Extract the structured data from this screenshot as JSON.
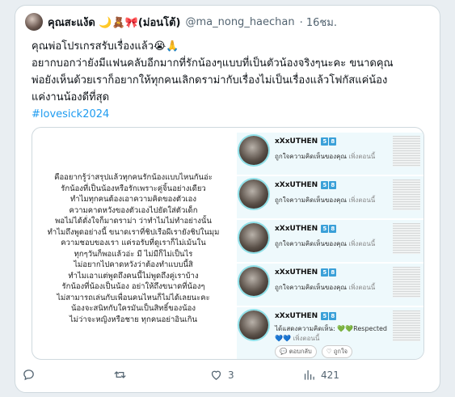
{
  "tweet": {
    "display_name": "คุณสะแง้ด 🌙🧸🎀(ม่อนโต้)",
    "handle": "@ma_nong_haechan",
    "time": "· 16ชม.",
    "lines": [
      "คุณพ่อโปรเกรสรับเรื่องแล้ว😭🙏",
      "อยากบอกว่ายังมีแฟนคลับอีกมากที่รักน้องๆแบบที่เป็นตัวน้องจริงๆนะคะ ขนาดคุณ",
      "พ่อยังเห็นด้วยเราก็อยากให้ทุกคนเลิกดราม่ากับเรื่องไม่เป็นเรื่องแล้วโฟกัสแค่น้อง",
      "แค่งานน้องดีที่สุด",
      "#lovesick2024"
    ]
  },
  "media": {
    "left_text": [
      "คืออยากรู้ว่าสรุปแล้วทุกคนรักน้องแบบไหนกันอ่ะ",
      "รักน้องที่เป็นน้องหรือรักเพราะคู่จิ้นอย่างเดียว",
      "ทำไมทุกคนต้องเอาความคิดของตัวเอง",
      "ความคาดหวังของตัวเองไปยัดใส่ตัวเด็ก",
      "พอไม่ได้ดั่งใจก็มาดราม่า ว่าทำไมไม่ทำอย่างนั้น",
      "ทำไมถึงพูดอย่างนี้ ขนาดเราที่ชิปเรือผีเรายังชิปในมุม",
      "ความชอบของเรา แค่รอรับที่ดูเราก็ไม่เม้นใน",
      "ทุกๆวันก็พอแล้วอ่ะ มี ไม่มีก็ไม่เป็นไร",
      "ไม่อยากไปคาดหวังว่าต้องทำแบบนี้สิ",
      "ทำไมเอาแต่พูดถึงคนนี้ไม่พูดถึงคู่เราบ้าง",
      "รักน้องที่น้องเป็นน้อง อย่าให้ถึงขนาดที่น้องๆ",
      "ไม่สามารถเล่นกับเพื่อนคนไหนก็ไม่ได้เลยนะคะ",
      "น้องจะสนิทกับใครมันเป็นสิทธิ์ของน้อง",
      "ไม่ว่าจะหญิงหรือชาย ทุกคนอย่าอินเกิน"
    ],
    "notifications": [
      {
        "user": "xXxUTHEN",
        "badges": [
          "5",
          "8"
        ],
        "text": "ถูกใจความคิดเห็นของคุณ",
        "time": "เพิ่งตอนนี้"
      },
      {
        "user": "xXxUTHEN",
        "badges": [
          "5",
          "8"
        ],
        "text": "ถูกใจความคิดเห็นของคุณ",
        "time": "เพิ่งตอนนี้"
      },
      {
        "user": "xXxUTHEN",
        "badges": [
          "5",
          "8"
        ],
        "text": "ถูกใจความคิดเห็นของคุณ",
        "time": "เพิ่งตอนนี้"
      },
      {
        "user": "xXxUTHEN",
        "badges": [
          "5",
          "8"
        ],
        "text": "ถูกใจความคิดเห็นของคุณ",
        "time": "เพิ่งตอนนี้"
      }
    ],
    "reply_notification": {
      "user": "xXxUTHEN",
      "badges": [
        "5",
        "8"
      ],
      "text": "ได้แสดงความคิดเห็น: 💚💚Respected",
      "text2": "💙💙",
      "time": "เพิ่งตอนนี้",
      "reply_label": "ตอบกลับ",
      "like_label": "ถูกใจ"
    }
  },
  "actions": {
    "reply_count": "",
    "retweet_count": "",
    "like_count": "3",
    "views_count": "421"
  }
}
